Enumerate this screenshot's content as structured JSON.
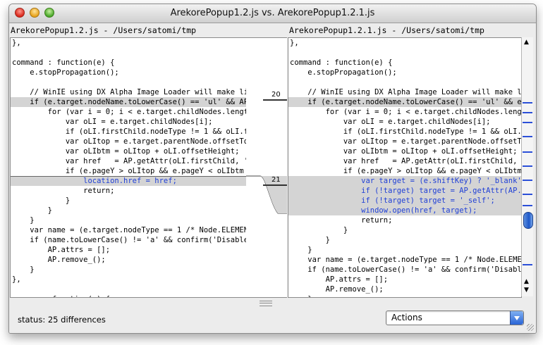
{
  "window": {
    "title": "ArekorePopup1.2.js vs. ArekorePopup1.2.1.js"
  },
  "left": {
    "header": "ArekorePopup1.2.js - /Users/satomi/tmp",
    "lines": [
      {
        "text": "},",
        "hl": false,
        "blue": false
      },
      {
        "text": "",
        "hl": false,
        "blue": false
      },
      {
        "text": "command : function(e) {",
        "hl": false,
        "blue": false
      },
      {
        "text": "    e.stopPropagation();",
        "hl": false,
        "blue": false
      },
      {
        "text": "",
        "hl": false,
        "blue": false
      },
      {
        "text": "    // WinIE using DX Alpha Image Loader will make link",
        "hl": false,
        "blue": false
      },
      {
        "text": "    if (e.target.nodeName.toLowerCase() == 'ul' && AP.r",
        "hl": true,
        "blue": false
      },
      {
        "text": "        for (var i = 0; i < e.target.childNodes.length",
        "hl": false,
        "blue": false
      },
      {
        "text": "            var oLI = e.target.childNodes[i];",
        "hl": false,
        "blue": false
      },
      {
        "text": "            if (oLI.firstChild.nodeType != 1 && oLI.f",
        "hl": false,
        "blue": false
      },
      {
        "text": "            var oLItop = e.target.parentNode.offsetTo",
        "hl": false,
        "blue": false
      },
      {
        "text": "            var oLIbtm = oLItop + oLI.offsetHeight;",
        "hl": false,
        "blue": false
      },
      {
        "text": "            var href   = AP.getAttr(oLI.firstChild, '",
        "hl": false,
        "blue": false
      },
      {
        "text": "            if (e.pageY > oLItop && e.pageY < oLIbtm",
        "hl": false,
        "blue": false
      },
      {
        "text": "                location.href = href;",
        "hl": true,
        "blue": true
      },
      {
        "text": "                return;",
        "hl": false,
        "blue": false
      },
      {
        "text": "            }",
        "hl": false,
        "blue": false
      },
      {
        "text": "        }",
        "hl": false,
        "blue": false
      },
      {
        "text": "    }",
        "hl": false,
        "blue": false
      },
      {
        "text": "    var name = (e.target.nodeType == 1 /* Node.ELEMENT_",
        "hl": false,
        "blue": false
      },
      {
        "text": "    if (name.toLowerCase() != 'a' && confirm('Disable '",
        "hl": false,
        "blue": false
      },
      {
        "text": "        AP.attrs = [];",
        "hl": false,
        "blue": false
      },
      {
        "text": "        AP.remove_();",
        "hl": false,
        "blue": false
      },
      {
        "text": "    }",
        "hl": false,
        "blue": false
      },
      {
        "text": "},",
        "hl": false,
        "blue": false
      },
      {
        "text": "",
        "hl": false,
        "blue": false
      },
      {
        "text": "remove : function(e) {",
        "hl": false,
        "blue": false
      }
    ]
  },
  "right": {
    "header": "ArekorePopup1.2.1.js - /Users/satomi/tmp",
    "lines": [
      {
        "text": "},",
        "hl": false,
        "blue": false
      },
      {
        "text": "",
        "hl": false,
        "blue": false
      },
      {
        "text": "command : function(e) {",
        "hl": false,
        "blue": false
      },
      {
        "text": "    e.stopPropagation();",
        "hl": false,
        "blue": false
      },
      {
        "text": "",
        "hl": false,
        "blue": false
      },
      {
        "text": "    // WinIE using DX Alpha Image Loader will make li",
        "hl": false,
        "blue": false
      },
      {
        "text": "    if (e.target.nodeName.toLowerCase() == 'ul' && e.t",
        "hl": true,
        "blue": false
      },
      {
        "text": "        for (var i = 0; i < e.target.childNodes.length",
        "hl": false,
        "blue": false
      },
      {
        "text": "            var oLI = e.target.childNodes[i];",
        "hl": false,
        "blue": false
      },
      {
        "text": "            if (oLI.firstChild.nodeType != 1 && oLI.f",
        "hl": false,
        "blue": false
      },
      {
        "text": "            var oLItop = e.target.parentNode.offsetTo",
        "hl": false,
        "blue": false
      },
      {
        "text": "            var oLIbtm = oLItop + oLI.offsetHeight;",
        "hl": false,
        "blue": false
      },
      {
        "text": "            var href   = AP.getAttr(oLI.firstChild, '",
        "hl": false,
        "blue": false
      },
      {
        "text": "            if (e.pageY > oLItop && e.pageY < oLIbtm",
        "hl": false,
        "blue": false
      },
      {
        "text": "                var target = (e.shiftKey) ? '_blank'",
        "hl": true,
        "blue": true
      },
      {
        "text": "                if (!target) target = AP.getAttr(AP.",
        "hl": true,
        "blue": true
      },
      {
        "text": "                if (!target) target = '_self';",
        "hl": true,
        "blue": true
      },
      {
        "text": "                window.open(href, target);",
        "hl": true,
        "blue": true
      },
      {
        "text": "                return;",
        "hl": false,
        "blue": false
      },
      {
        "text": "            }",
        "hl": false,
        "blue": false
      },
      {
        "text": "        }",
        "hl": false,
        "blue": false
      },
      {
        "text": "    }",
        "hl": false,
        "blue": false
      },
      {
        "text": "    var name = (e.target.nodeType == 1 /* Node.ELEMENT",
        "hl": false,
        "blue": false
      },
      {
        "text": "    if (name.toLowerCase() != 'a' && confirm('Disable",
        "hl": false,
        "blue": false
      },
      {
        "text": "        AP.attrs = [];",
        "hl": false,
        "blue": false
      },
      {
        "text": "        AP.remove_();",
        "hl": false,
        "blue": false
      },
      {
        "text": "    }",
        "hl": false,
        "blue": false
      }
    ]
  },
  "diffs": [
    {
      "label": "20"
    },
    {
      "label": "21"
    }
  ],
  "status": {
    "text": "status: 25 differences"
  },
  "actions": {
    "label": "Actions"
  },
  "colors": {
    "highlight": "#d4d4d4",
    "changed_text": "#1f3fd6",
    "scroll_mark": "#2b4fd8"
  },
  "icons": {
    "close": "close-button-icon",
    "minimize": "minimize-button-icon",
    "zoom": "zoom-button-icon",
    "diff_arrow": "right-arrow-icon",
    "dropdown": "chevron-down-icon"
  }
}
